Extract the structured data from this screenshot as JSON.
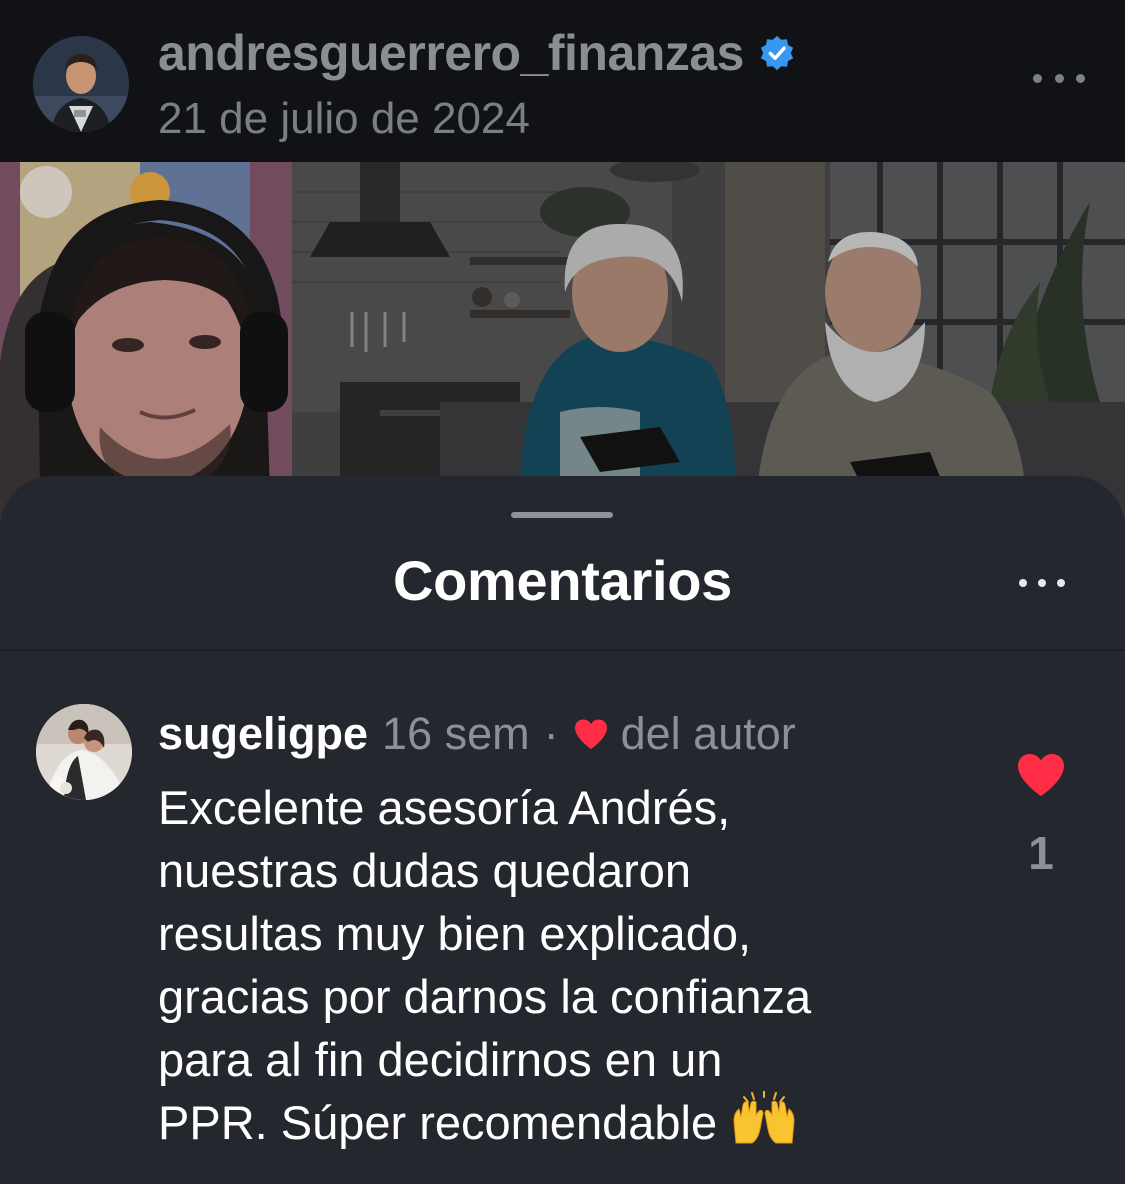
{
  "post_header": {
    "username": "andresguerrero_finanzas",
    "date": "21 de julio de 2024",
    "verified_icon": "verified-badge-icon",
    "more_icon": "more-horizontal-icon"
  },
  "video": {
    "description_icon": "video-frame"
  },
  "comments_sheet": {
    "title": "Comentarios",
    "more_icon": "more-horizontal-icon",
    "comments": [
      {
        "username": "sugeligpe",
        "time": "16 sem",
        "separator": "·",
        "author_like_icon": "heart-icon",
        "author_like_label": "del autor",
        "text_lines": [
          "Excelente asesoría Andrés,",
          "nuestras dudas quedaron",
          "resultas muy bien explicado,",
          "gracias por darnos la confianza",
          "para al fin decidirnos en un",
          "PPR. Súper recomendable"
        ],
        "emoji": "🙌",
        "like_count": "1",
        "liked": true
      }
    ]
  },
  "colors": {
    "sheet_bg": "#24272d",
    "header_bg": "#111215",
    "heart_red": "#ff2d45",
    "verified_blue": "#3897f0",
    "muted_text": "#8d9096"
  }
}
